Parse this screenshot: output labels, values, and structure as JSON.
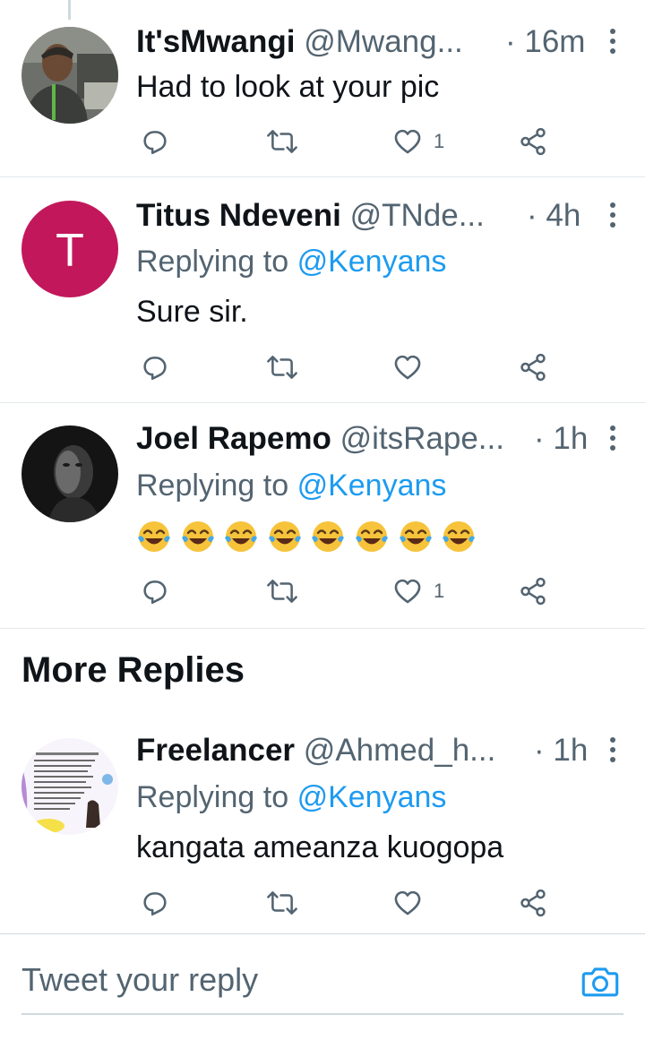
{
  "tweets": [
    {
      "display_name": "It'sMwangi",
      "handle": "@Mwang...",
      "time": "· 16m",
      "replying_prefix": "",
      "replying_to": "",
      "text": "Had to look at your pic",
      "like_count": "1",
      "avatar": "photo"
    },
    {
      "display_name": "Titus Ndeveni",
      "handle": "@TNde...",
      "time": "· 4h",
      "replying_prefix": "Replying to",
      "replying_to": "@Kenyans",
      "text": "Sure sir.",
      "like_count": "",
      "avatar": "letter",
      "avatar_letter": "T",
      "avatar_color": "#c2185b"
    },
    {
      "display_name": "Joel Rapemo",
      "handle": "@itsRape...",
      "time": "· 1h",
      "replying_prefix": "Replying to",
      "replying_to": "@Kenyans",
      "text": "😂😂😂😂😂😂😂😂",
      "like_count": "1",
      "avatar": "photo"
    },
    {
      "display_name": "Freelancer",
      "handle": "@Ahmed_h...",
      "time": "· 1h",
      "replying_prefix": "Replying to",
      "replying_to": "@Kenyans",
      "text": "kangata ameanza kuogopa",
      "like_count": "",
      "avatar": "flyer"
    }
  ],
  "section_title": "More Replies",
  "composer": {
    "placeholder": "Tweet your reply",
    "camera_icon": "camera-icon"
  },
  "colors": {
    "link": "#1d9bf0",
    "muted": "#536471",
    "text": "#0f1419",
    "divider": "#e3e8eb"
  },
  "icons": [
    "reply-icon",
    "retweet-icon",
    "like-icon",
    "share-icon",
    "more-icon",
    "camera-icon"
  ]
}
